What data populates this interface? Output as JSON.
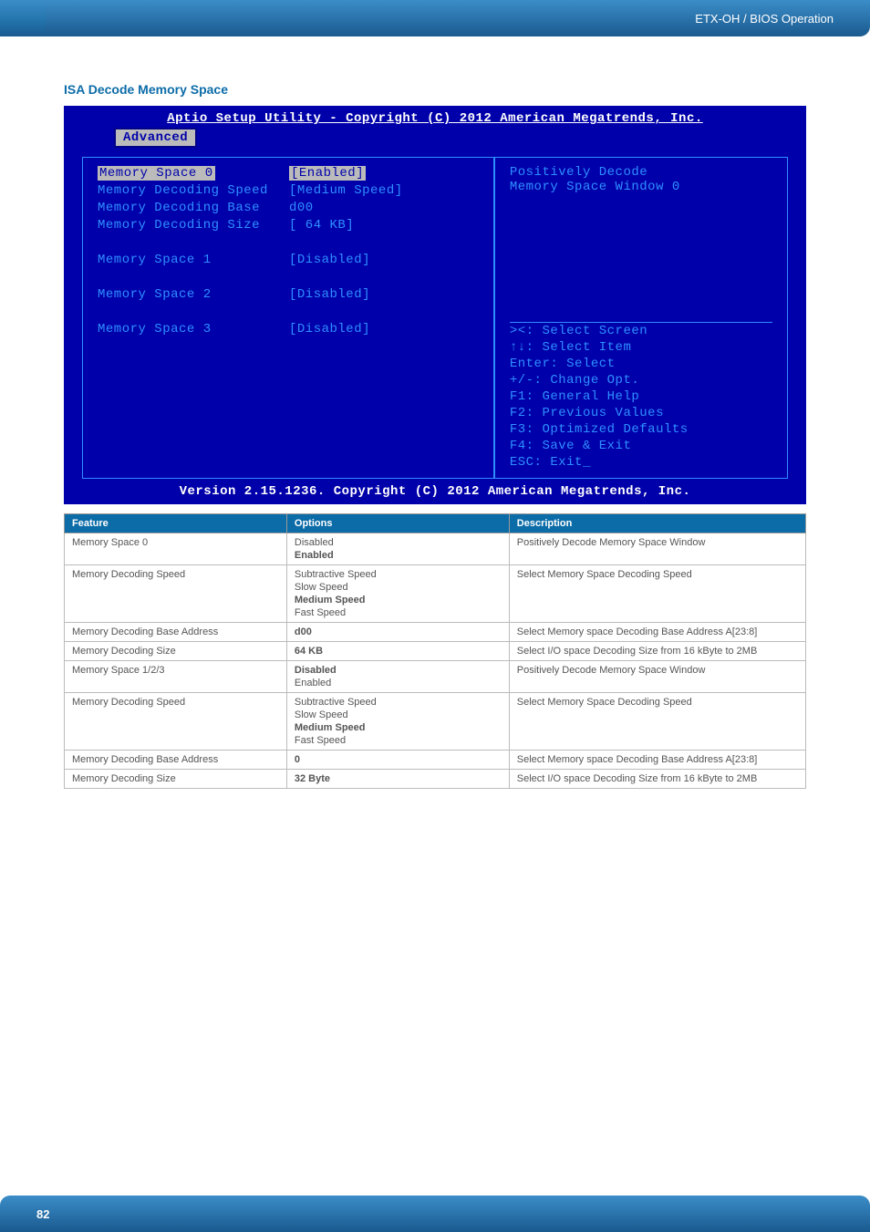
{
  "header": {
    "breadcrumb": "ETX-OH / BIOS Operation"
  },
  "section": {
    "title": "ISA Decode Memory Space"
  },
  "bios": {
    "title": "Aptio Setup Utility - Copyright (C) 2012 American Megatrends, Inc.",
    "tab": "Advanced",
    "rows": [
      {
        "label": "Memory Space 0",
        "value": "[Enabled]",
        "selected": true
      },
      {
        "label": "Memory Decoding Speed",
        "value": "[Medium Speed]",
        "cyan": true
      },
      {
        "label": "Memory Decoding Base",
        "value": "d00",
        "cyan": true
      },
      {
        "label": "Memory Decoding Size",
        "value": "[ 64 KB]",
        "cyan": true
      }
    ],
    "rows2": [
      {
        "label": "Memory Space 1",
        "value": "[Disabled]"
      },
      {
        "label": "Memory Space 2",
        "value": "[Disabled]"
      },
      {
        "label": "Memory Space 3",
        "value": "[Disabled]"
      }
    ],
    "help_line1": "Positively Decode",
    "help_line2": "Memory Space Window 0",
    "nav": [
      "><: Select Screen",
      "↑↓: Select Item",
      "Enter: Select",
      "+/-: Change Opt.",
      "F1: General Help",
      "F2: Previous Values",
      "F3: Optimized Defaults",
      "F4: Save & Exit",
      "ESC: Exit_"
    ],
    "footer": "Version 2.15.1236. Copyright (C) 2012 American Megatrends, Inc."
  },
  "table": {
    "headers": {
      "feature": "Feature",
      "options": "Options",
      "description": "Description"
    },
    "rows": [
      {
        "feature": "Memory Space 0",
        "options": [
          {
            "text": "Disabled",
            "bold": false
          },
          {
            "text": "Enabled",
            "bold": true
          }
        ],
        "description": "Positively Decode Memory Space Window"
      },
      {
        "feature": "Memory Decoding Speed",
        "options": [
          {
            "text": "Subtractive Speed",
            "bold": false
          },
          {
            "text": "Slow Speed",
            "bold": false
          },
          {
            "text": "Medium Speed",
            "bold": true
          },
          {
            "text": "Fast Speed",
            "bold": false
          }
        ],
        "description": "Select Memory Space Decoding Speed"
      },
      {
        "feature": "Memory Decoding Base Address",
        "options": [
          {
            "text": "d00",
            "bold": true
          }
        ],
        "description": "Select Memory space Decoding Base Address A[23:8]"
      },
      {
        "feature": "Memory Decoding Size",
        "options": [
          {
            "text": "64 KB",
            "bold": true
          }
        ],
        "description": "Select I/O space Decoding Size from 16 kByte to 2MB"
      },
      {
        "feature": "Memory Space 1/2/3",
        "options": [
          {
            "text": "Disabled",
            "bold": true
          },
          {
            "text": "Enabled",
            "bold": false
          }
        ],
        "description": "Positively Decode Memory Space Window"
      },
      {
        "feature": "Memory Decoding Speed",
        "options": [
          {
            "text": "Subtractive Speed",
            "bold": false
          },
          {
            "text": "Slow Speed",
            "bold": false
          },
          {
            "text": "Medium Speed",
            "bold": true
          },
          {
            "text": "Fast Speed",
            "bold": false
          }
        ],
        "description": "Select Memory Space Decoding Speed"
      },
      {
        "feature": "Memory Decoding Base Address",
        "options": [
          {
            "text": "0",
            "bold": true
          }
        ],
        "description": "Select Memory space Decoding Base Address A[23:8]"
      },
      {
        "feature": "Memory Decoding Size",
        "options": [
          {
            "text": "32 Byte",
            "bold": true
          }
        ],
        "description": "Select I/O space Decoding Size from 16 kByte to 2MB"
      }
    ]
  },
  "footer": {
    "page": "82"
  }
}
